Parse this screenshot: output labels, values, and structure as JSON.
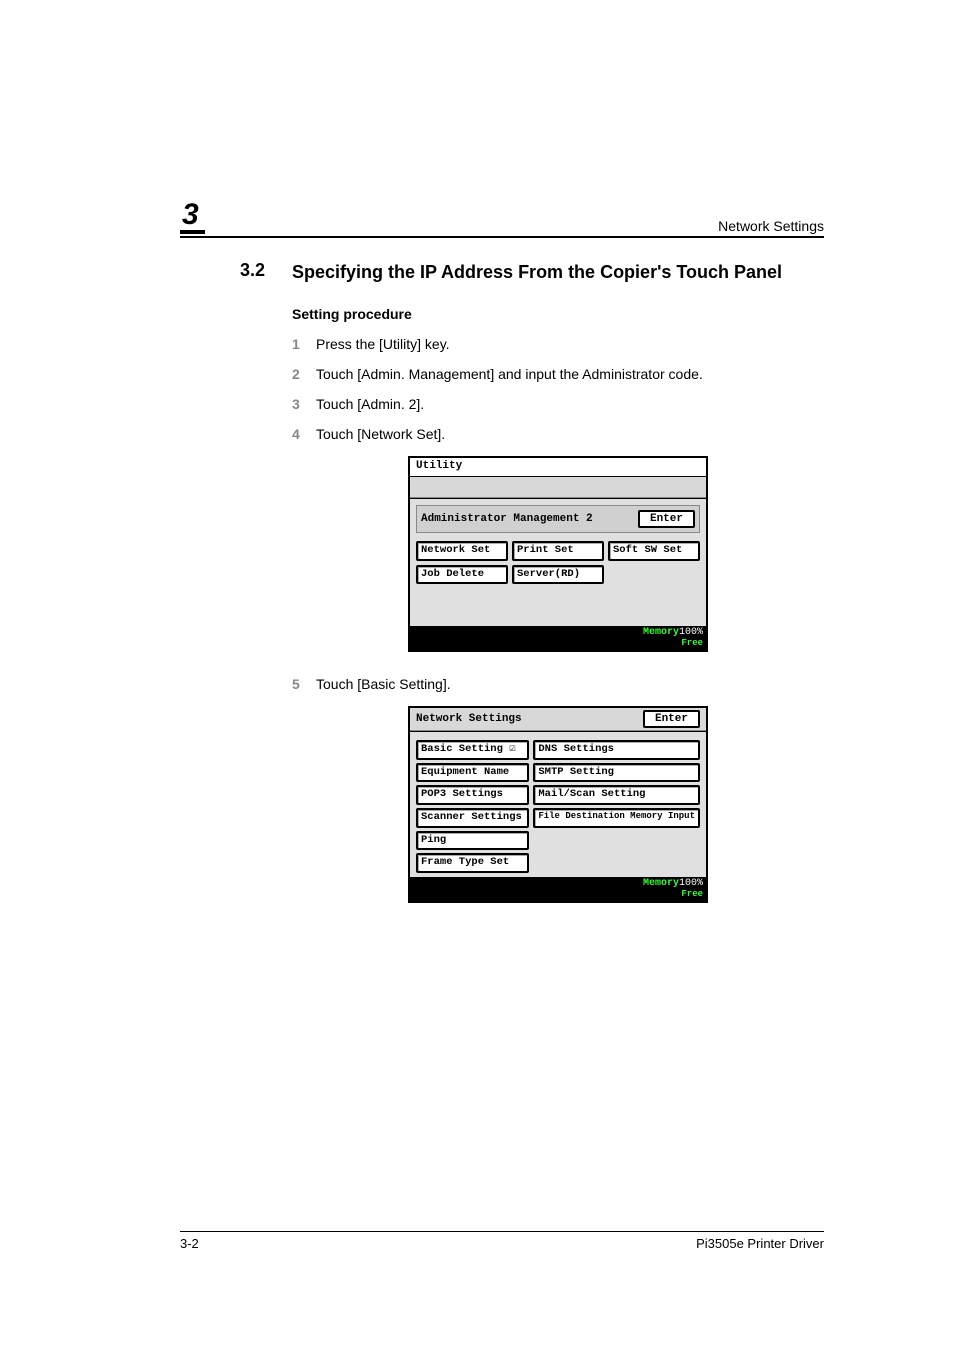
{
  "header": {
    "chapter": "3",
    "right": "Network Settings"
  },
  "section": {
    "number": "3.2",
    "title": "Specifying the IP Address From the Copier's Touch Panel"
  },
  "subheading": "Setting procedure",
  "steps": [
    {
      "num": "1",
      "text": "Press the [Utility] key."
    },
    {
      "num": "2",
      "text": "Touch [Admin. Management] and input the Administrator code."
    },
    {
      "num": "3",
      "text": "Touch [Admin. 2]."
    },
    {
      "num": "4",
      "text": "Touch [Network Set]."
    },
    {
      "num": "5",
      "text": "Touch [Basic Setting]."
    }
  ],
  "screen1": {
    "title": "Utility",
    "inset_label": "Administrator Management 2",
    "enter": "Enter",
    "buttons": [
      "Network Set",
      "Print Set",
      "Soft SW Set",
      "Job Delete",
      "Server(RD)"
    ],
    "mem_label": "Memory",
    "mem_free": "Free",
    "mem_val": "100%"
  },
  "screen2": {
    "title": "Network Settings",
    "enter": "Enter",
    "left": [
      "Basic Setting ☑",
      "Equipment Name",
      "POP3 Settings",
      "Scanner Settings",
      "Ping",
      "Frame Type Set"
    ],
    "right": [
      "DNS Settings",
      "SMTP Setting",
      "Mail/Scan Setting",
      "File Destination\nMemory Input"
    ],
    "mem_label": "Memory",
    "mem_free": "Free",
    "mem_val": "100%"
  },
  "footer": {
    "left": "3-2",
    "right": "Pi3505e Printer Driver"
  }
}
